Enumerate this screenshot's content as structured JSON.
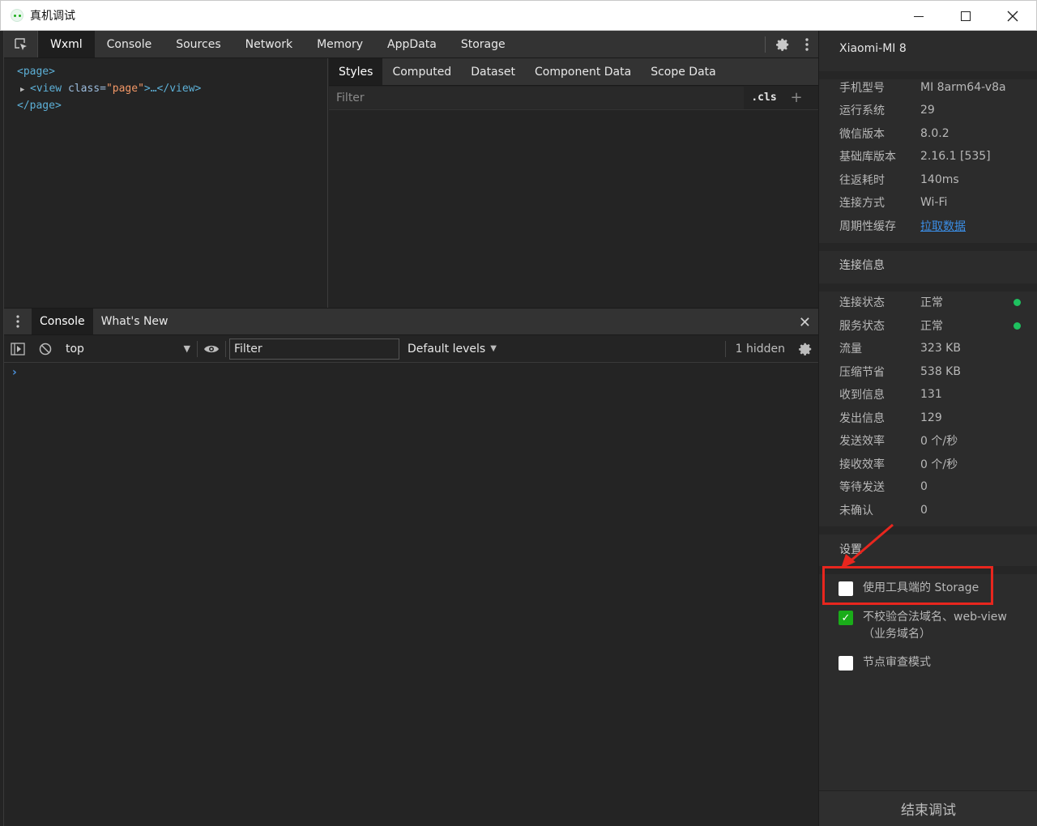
{
  "window": {
    "title": "真机调试"
  },
  "toolbar": {
    "tabs": [
      "Wxml",
      "Console",
      "Sources",
      "Network",
      "Memory",
      "AppData",
      "Storage"
    ],
    "active_tab": "Wxml"
  },
  "elements": {
    "line1": "<page>",
    "line2_open": "<view ",
    "line2_attr": "class=",
    "line2_val": "\"page\"",
    "line2_rest": ">…</view>",
    "line3": "</page>"
  },
  "styles": {
    "tabs": [
      "Styles",
      "Computed",
      "Dataset",
      "Component Data",
      "Scope Data"
    ],
    "filter_placeholder": "Filter",
    "cls_label": ".cls",
    "plus_label": "+"
  },
  "drawer": {
    "tabs": [
      "Console",
      "What's New"
    ],
    "close_label": "✕"
  },
  "console": {
    "context": "top",
    "filter_value": "Filter",
    "levels": "Default levels",
    "hidden": "1 hidden",
    "prompt": "›"
  },
  "device": {
    "name": "Xiaomi-MI 8",
    "info": [
      {
        "key": "手机型号",
        "value": "MI 8arm64-v8a"
      },
      {
        "key": "运行系统",
        "value": "29"
      },
      {
        "key": "微信版本",
        "value": "8.0.2"
      },
      {
        "key": "基础库版本",
        "value": "2.16.1 [535]"
      },
      {
        "key": "往返耗时",
        "value": "140ms"
      },
      {
        "key": "连接方式",
        "value": "Wi-Fi"
      },
      {
        "key": "周期性缓存",
        "value": "拉取数据"
      }
    ],
    "connection_title": "连接信息",
    "connection": [
      {
        "key": "连接状态",
        "value": "正常"
      },
      {
        "key": "服务状态",
        "value": "正常"
      },
      {
        "key": "流量",
        "value": "323 KB"
      },
      {
        "key": "压缩节省",
        "value": "538 KB"
      },
      {
        "key": "收到信息",
        "value": "131"
      },
      {
        "key": "发出信息",
        "value": "129"
      },
      {
        "key": "发送效率",
        "value": "0 个/秒"
      },
      {
        "key": "接收效率",
        "value": "0 个/秒"
      },
      {
        "key": "等待发送",
        "value": "0"
      },
      {
        "key": "未确认",
        "value": "0"
      }
    ],
    "settings_title": "设置",
    "settings": [
      {
        "label": "使用工具端的 Storage",
        "checked": false
      },
      {
        "label": "不校验合法域名、web-view（业务域名）",
        "checked": true
      },
      {
        "label": "节点审查模式",
        "checked": false
      }
    ],
    "end_button": "结束调试",
    "status_color": "#1ec15f"
  }
}
